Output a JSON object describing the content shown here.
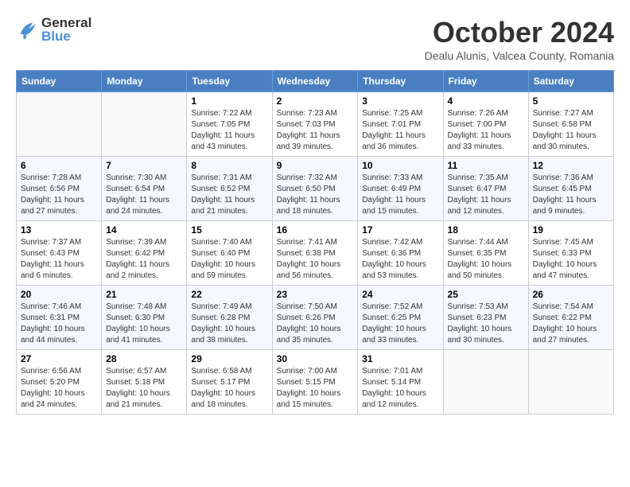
{
  "header": {
    "logo_general": "General",
    "logo_blue": "Blue",
    "month_title": "October 2024",
    "location": "Dealu Alunis, Valcea County, Romania"
  },
  "days_of_week": [
    "Sunday",
    "Monday",
    "Tuesday",
    "Wednesday",
    "Thursday",
    "Friday",
    "Saturday"
  ],
  "weeks": [
    [
      {
        "day": "",
        "info": ""
      },
      {
        "day": "",
        "info": ""
      },
      {
        "day": "1",
        "info": "Sunrise: 7:22 AM\nSunset: 7:05 PM\nDaylight: 11 hours and 43 minutes."
      },
      {
        "day": "2",
        "info": "Sunrise: 7:23 AM\nSunset: 7:03 PM\nDaylight: 11 hours and 39 minutes."
      },
      {
        "day": "3",
        "info": "Sunrise: 7:25 AM\nSunset: 7:01 PM\nDaylight: 11 hours and 36 minutes."
      },
      {
        "day": "4",
        "info": "Sunrise: 7:26 AM\nSunset: 7:00 PM\nDaylight: 11 hours and 33 minutes."
      },
      {
        "day": "5",
        "info": "Sunrise: 7:27 AM\nSunset: 6:58 PM\nDaylight: 11 hours and 30 minutes."
      }
    ],
    [
      {
        "day": "6",
        "info": "Sunrise: 7:28 AM\nSunset: 6:56 PM\nDaylight: 11 hours and 27 minutes."
      },
      {
        "day": "7",
        "info": "Sunrise: 7:30 AM\nSunset: 6:54 PM\nDaylight: 11 hours and 24 minutes."
      },
      {
        "day": "8",
        "info": "Sunrise: 7:31 AM\nSunset: 6:52 PM\nDaylight: 11 hours and 21 minutes."
      },
      {
        "day": "9",
        "info": "Sunrise: 7:32 AM\nSunset: 6:50 PM\nDaylight: 11 hours and 18 minutes."
      },
      {
        "day": "10",
        "info": "Sunrise: 7:33 AM\nSunset: 6:49 PM\nDaylight: 11 hours and 15 minutes."
      },
      {
        "day": "11",
        "info": "Sunrise: 7:35 AM\nSunset: 6:47 PM\nDaylight: 11 hours and 12 minutes."
      },
      {
        "day": "12",
        "info": "Sunrise: 7:36 AM\nSunset: 6:45 PM\nDaylight: 11 hours and 9 minutes."
      }
    ],
    [
      {
        "day": "13",
        "info": "Sunrise: 7:37 AM\nSunset: 6:43 PM\nDaylight: 11 hours and 6 minutes."
      },
      {
        "day": "14",
        "info": "Sunrise: 7:39 AM\nSunset: 6:42 PM\nDaylight: 11 hours and 2 minutes."
      },
      {
        "day": "15",
        "info": "Sunrise: 7:40 AM\nSunset: 6:40 PM\nDaylight: 10 hours and 59 minutes."
      },
      {
        "day": "16",
        "info": "Sunrise: 7:41 AM\nSunset: 6:38 PM\nDaylight: 10 hours and 56 minutes."
      },
      {
        "day": "17",
        "info": "Sunrise: 7:42 AM\nSunset: 6:36 PM\nDaylight: 10 hours and 53 minutes."
      },
      {
        "day": "18",
        "info": "Sunrise: 7:44 AM\nSunset: 6:35 PM\nDaylight: 10 hours and 50 minutes."
      },
      {
        "day": "19",
        "info": "Sunrise: 7:45 AM\nSunset: 6:33 PM\nDaylight: 10 hours and 47 minutes."
      }
    ],
    [
      {
        "day": "20",
        "info": "Sunrise: 7:46 AM\nSunset: 6:31 PM\nDaylight: 10 hours and 44 minutes."
      },
      {
        "day": "21",
        "info": "Sunrise: 7:48 AM\nSunset: 6:30 PM\nDaylight: 10 hours and 41 minutes."
      },
      {
        "day": "22",
        "info": "Sunrise: 7:49 AM\nSunset: 6:28 PM\nDaylight: 10 hours and 38 minutes."
      },
      {
        "day": "23",
        "info": "Sunrise: 7:50 AM\nSunset: 6:26 PM\nDaylight: 10 hours and 35 minutes."
      },
      {
        "day": "24",
        "info": "Sunrise: 7:52 AM\nSunset: 6:25 PM\nDaylight: 10 hours and 33 minutes."
      },
      {
        "day": "25",
        "info": "Sunrise: 7:53 AM\nSunset: 6:23 PM\nDaylight: 10 hours and 30 minutes."
      },
      {
        "day": "26",
        "info": "Sunrise: 7:54 AM\nSunset: 6:22 PM\nDaylight: 10 hours and 27 minutes."
      }
    ],
    [
      {
        "day": "27",
        "info": "Sunrise: 6:56 AM\nSunset: 5:20 PM\nDaylight: 10 hours and 24 minutes."
      },
      {
        "day": "28",
        "info": "Sunrise: 6:57 AM\nSunset: 5:18 PM\nDaylight: 10 hours and 21 minutes."
      },
      {
        "day": "29",
        "info": "Sunrise: 6:58 AM\nSunset: 5:17 PM\nDaylight: 10 hours and 18 minutes."
      },
      {
        "day": "30",
        "info": "Sunrise: 7:00 AM\nSunset: 5:15 PM\nDaylight: 10 hours and 15 minutes."
      },
      {
        "day": "31",
        "info": "Sunrise: 7:01 AM\nSunset: 5:14 PM\nDaylight: 10 hours and 12 minutes."
      },
      {
        "day": "",
        "info": ""
      },
      {
        "day": "",
        "info": ""
      }
    ]
  ]
}
